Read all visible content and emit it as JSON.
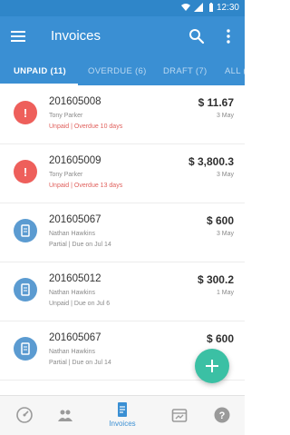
{
  "status_bar": {
    "time": "12:30"
  },
  "app_bar": {
    "title": "Invoices"
  },
  "tabs": [
    {
      "label": "UNPAID (11)"
    },
    {
      "label": "OVERDUE (6)"
    },
    {
      "label": "DRAFT (7)"
    },
    {
      "label": "ALL ("
    }
  ],
  "invoices": [
    {
      "number": "201605008",
      "client": "Tony Parker",
      "status": "Unpaid | Overdue 10 days",
      "amount": "$ 11.67",
      "date": "3 May",
      "icon": "alert-icon",
      "tone": "overdue"
    },
    {
      "number": "201605009",
      "client": "Tony Parker",
      "status": "Unpaid | Overdue 13 days",
      "amount": "$ 3,800.3",
      "date": "3 May",
      "icon": "alert-icon",
      "tone": "overdue"
    },
    {
      "number": "201605067",
      "client": "Nathan Hawkins",
      "status": "Partial | Due on Jul 14",
      "amount": "$ 600",
      "date": "3 May",
      "icon": "document-icon",
      "tone": "due"
    },
    {
      "number": "201605012",
      "client": "Nathan Hawkins",
      "status": "Unpaid | Due on Jul 6",
      "amount": "$ 300.2",
      "date": "1 May",
      "icon": "document-icon",
      "tone": "due"
    },
    {
      "number": "201605067",
      "client": "Nathan Hawkins",
      "status": "Partial | Due on Jul 14",
      "amount": "$ 600",
      "date": "",
      "icon": "document-icon",
      "tone": "due"
    }
  ],
  "bottom_nav": [
    {
      "label": "",
      "icon": "dashboard-icon"
    },
    {
      "label": "",
      "icon": "clients-icon"
    },
    {
      "label": "Invoices",
      "icon": "invoice-icon",
      "active": true
    },
    {
      "label": "",
      "icon": "calendar-icon"
    },
    {
      "label": "",
      "icon": "help-icon"
    }
  ],
  "colors": {
    "primary": "#3a8fd3",
    "status_bar": "#2f86c9",
    "overdue": "#ee5f5b",
    "due": "#5b9bd1",
    "fab": "#3bc0a4"
  }
}
